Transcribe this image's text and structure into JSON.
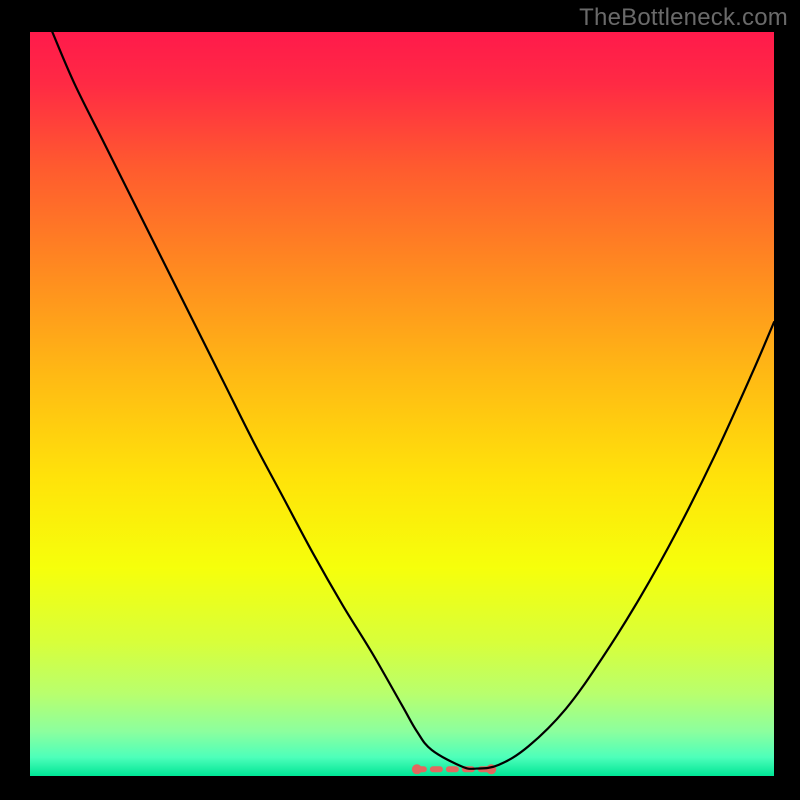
{
  "attribution": "TheBottleneck.com",
  "chart_data": {
    "type": "line",
    "title": "",
    "xlabel": "",
    "ylabel": "",
    "xlim": [
      0,
      100
    ],
    "ylim": [
      0,
      100
    ],
    "background_gradient": {
      "stops": [
        {
          "offset": 0.0,
          "color": "#ff1a4b"
        },
        {
          "offset": 0.07,
          "color": "#ff2a44"
        },
        {
          "offset": 0.18,
          "color": "#ff5a2f"
        },
        {
          "offset": 0.32,
          "color": "#ff8a20"
        },
        {
          "offset": 0.46,
          "color": "#ffb914"
        },
        {
          "offset": 0.6,
          "color": "#ffe30a"
        },
        {
          "offset": 0.72,
          "color": "#f6ff0b"
        },
        {
          "offset": 0.82,
          "color": "#d8ff3a"
        },
        {
          "offset": 0.89,
          "color": "#b8ff6e"
        },
        {
          "offset": 0.94,
          "color": "#8cff9e"
        },
        {
          "offset": 0.975,
          "color": "#4dffba"
        },
        {
          "offset": 1.0,
          "color": "#00e596"
        }
      ]
    },
    "series": [
      {
        "name": "bottleneck-curve",
        "color": "#000000",
        "width": 2.2,
        "x": [
          3,
          6,
          10,
          14,
          18,
          22,
          26,
          30,
          34,
          38,
          42,
          46,
          50,
          52,
          54,
          58,
          60,
          63,
          67,
          72,
          77,
          82,
          87,
          92,
          97,
          100
        ],
        "y": [
          100,
          93,
          85,
          77,
          69,
          61,
          53,
          45,
          37.5,
          30,
          23,
          16.5,
          9.5,
          6,
          3.5,
          1.3,
          1.0,
          1.5,
          4,
          9,
          16,
          24,
          33,
          43,
          54,
          61
        ]
      }
    ],
    "flat_segment": {
      "comment": "red dashed base between minimum region",
      "color": "#e2685f",
      "width": 6,
      "dash": [
        7,
        9
      ],
      "x_start": 52,
      "x_end": 62,
      "y": 0.9,
      "end_dots_radius": 5
    }
  }
}
